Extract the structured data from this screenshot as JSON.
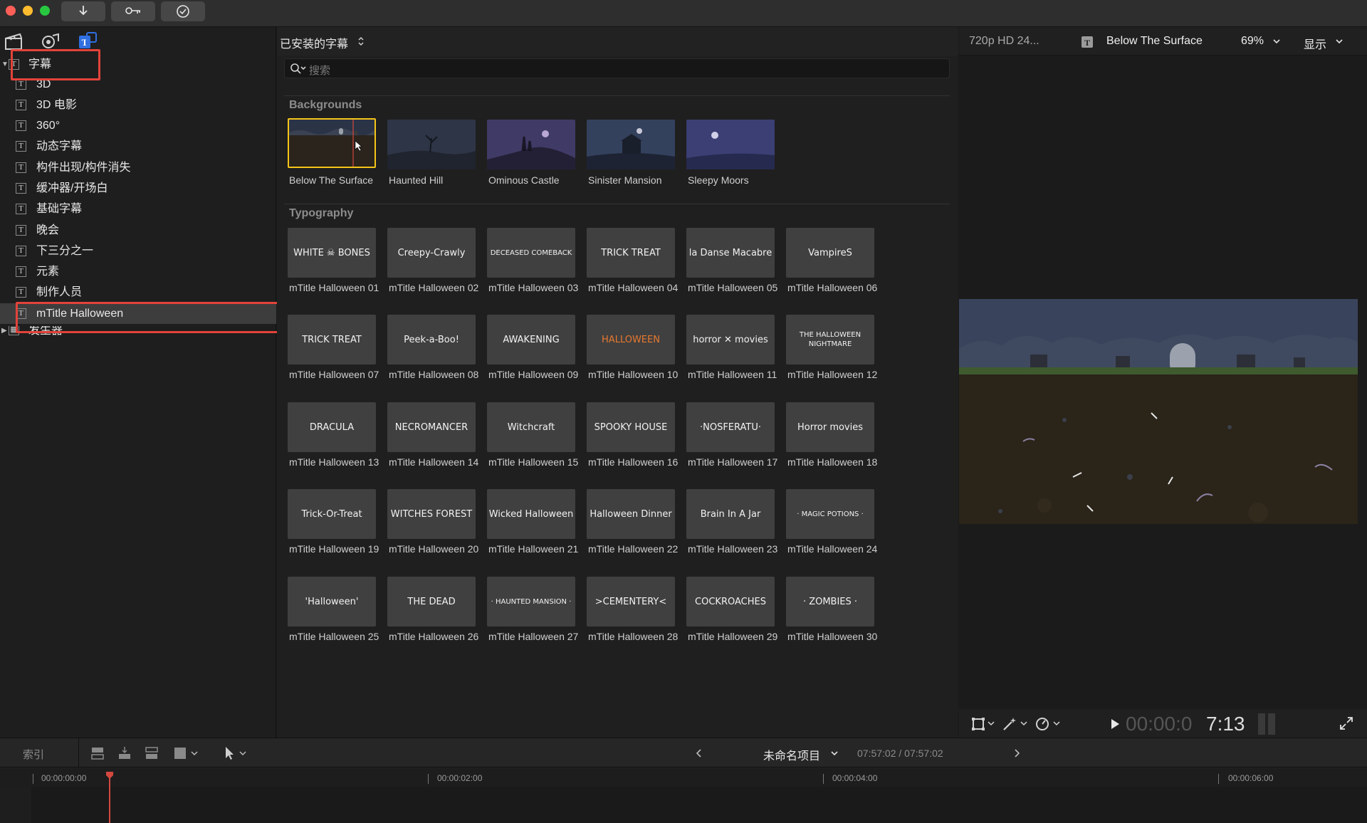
{
  "titlebar": {
    "buttons": [
      "import",
      "keywords",
      "background-tasks"
    ]
  },
  "sidebar": {
    "tool_icons": [
      "photos-and-audio-icon",
      "titles-and-generators-icon",
      "effects-icon"
    ],
    "items": [
      {
        "label": "字幕",
        "level": 0,
        "expanded": true
      },
      {
        "label": "3D",
        "level": 1
      },
      {
        "label": "3D 电影",
        "level": 1
      },
      {
        "label": "360°",
        "level": 1
      },
      {
        "label": "动态字幕",
        "level": 1
      },
      {
        "label": "构件出现/构件消失",
        "level": 1
      },
      {
        "label": "缓冲器/开场白",
        "level": 1
      },
      {
        "label": "基础字幕",
        "level": 1
      },
      {
        "label": "晚会",
        "level": 1
      },
      {
        "label": "下三分之一",
        "level": 1
      },
      {
        "label": "元素",
        "level": 1
      },
      {
        "label": "制作人员",
        "level": 1
      },
      {
        "label": "mTitle Halloween",
        "level": 1,
        "selected": true
      },
      {
        "label": "发生器",
        "level": 0,
        "expanded": false
      }
    ]
  },
  "browser": {
    "header": "已安装的字幕",
    "search_placeholder": "搜索",
    "sections": {
      "backgrounds": {
        "title": "Backgrounds",
        "items": [
          {
            "label": "Below The Surface",
            "selected": true
          },
          {
            "label": "Haunted Hill"
          },
          {
            "label": "Ominous Castle"
          },
          {
            "label": "Sinister Mansion"
          },
          {
            "label": "Sleepy Moors"
          }
        ]
      },
      "typography": {
        "title": "Typography",
        "items": [
          {
            "label": "mTitle Halloween 01",
            "thumb": "WHITE ☠ BONES"
          },
          {
            "label": "mTitle Halloween 02",
            "thumb": "Creepy-Crawly"
          },
          {
            "label": "mTitle Halloween 03",
            "thumb": "DECEASED COMEBACK"
          },
          {
            "label": "mTitle Halloween 04",
            "thumb": "TRICK TREAT"
          },
          {
            "label": "mTitle Halloween 05",
            "thumb": "la Danse Macabre"
          },
          {
            "label": "mTitle Halloween 06",
            "thumb": "VampireS"
          },
          {
            "label": "mTitle Halloween 07",
            "thumb": "TRICK TREAT"
          },
          {
            "label": "mTitle Halloween 08",
            "thumb": "Peek-a-Boo!"
          },
          {
            "label": "mTitle Halloween 09",
            "thumb": "AWAKENING"
          },
          {
            "label": "mTitle Halloween 10",
            "thumb": "HALLOWEEN"
          },
          {
            "label": "mTitle Halloween 11",
            "thumb": "horror ✕ movies"
          },
          {
            "label": "mTitle Halloween 12",
            "thumb": "THE HALLOWEEN NIGHTMARE"
          },
          {
            "label": "mTitle Halloween 13",
            "thumb": "DRACULA"
          },
          {
            "label": "mTitle Halloween 14",
            "thumb": "NECROMANCER"
          },
          {
            "label": "mTitle Halloween 15",
            "thumb": "Witchcraft"
          },
          {
            "label": "mTitle Halloween 16",
            "thumb": "SPOOKY HOUSE"
          },
          {
            "label": "mTitle Halloween 17",
            "thumb": "·NOSFERATU·"
          },
          {
            "label": "mTitle Halloween 18",
            "thumb": "Horror movies"
          },
          {
            "label": "mTitle Halloween 19",
            "thumb": "Trick-Or-Treat"
          },
          {
            "label": "mTitle Halloween 20",
            "thumb": "WITCHES FOREST"
          },
          {
            "label": "mTitle Halloween 21",
            "thumb": "Wicked Halloween"
          },
          {
            "label": "mTitle Halloween 22",
            "thumb": "Halloween Dinner"
          },
          {
            "label": "mTitle Halloween 23",
            "thumb": "Brain In A Jar"
          },
          {
            "label": "mTitle Halloween 24",
            "thumb": "· MAGIC POTIONS ·"
          },
          {
            "label": "mTitle Halloween 25",
            "thumb": "'Halloween'"
          },
          {
            "label": "mTitle Halloween 26",
            "thumb": "THE DEAD"
          },
          {
            "label": "mTitle Halloween 27",
            "thumb": "· HAUNTED MANSION ·"
          },
          {
            "label": "mTitle Halloween 28",
            "thumb": ">CEMENTERY<"
          },
          {
            "label": "mTitle Halloween 29",
            "thumb": "COCKROACHES"
          },
          {
            "label": "mTitle Halloween 30",
            "thumb": "· ZOMBIES ·"
          }
        ]
      }
    }
  },
  "viewer": {
    "format": "720p HD 24...",
    "clip_name": "Below The Surface",
    "zoom": "69%",
    "display_menu": "显示",
    "timecode_dim": "00:00:0",
    "timecode_bright": "7:13"
  },
  "timeline": {
    "index_label": "索引",
    "project_name": "未命名项目",
    "duration": "07:57:02 / 07:57:02",
    "ruler_marks": [
      "00:00:00:00",
      "00:00:02:00",
      "00:00:04:00",
      "00:00:06:00"
    ]
  },
  "colors": {
    "selection_red": "#e2433a",
    "thumb_selected": "#f5c518",
    "playhead": "#d3483f"
  }
}
